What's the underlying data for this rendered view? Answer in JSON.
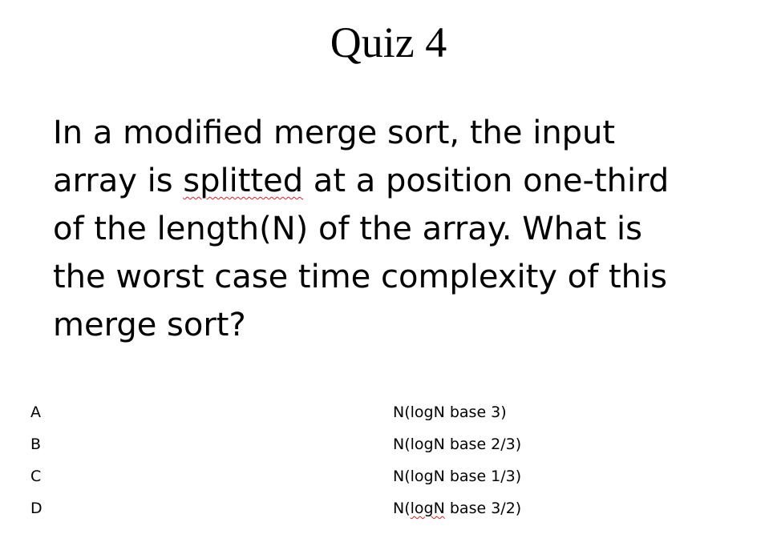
{
  "slide": {
    "title": "Quiz 4",
    "question_lines": [
      {
        "before": "In a modified merge sort, the input",
        "flagged": "",
        "after": ""
      },
      {
        "before": "array is ",
        "flagged": "splitted",
        "after": " at a position one-third"
      },
      {
        "before": "of the length(N) of the array. What is",
        "flagged": "",
        "after": ""
      },
      {
        "before": "the worst case time complexity of this",
        "flagged": "",
        "after": ""
      },
      {
        "before": "merge sort?",
        "flagged": "",
        "after": ""
      }
    ],
    "options": [
      {
        "letter": "A",
        "before": "N(logN base 3)",
        "flagged": "",
        "after": ""
      },
      {
        "letter": "B",
        "before": "N(logN base 2/3)",
        "flagged": "",
        "after": ""
      },
      {
        "letter": "C",
        "before": "N(logN base 1/3)",
        "flagged": "",
        "after": ""
      },
      {
        "letter": "D",
        "before": "N(",
        "flagged": "logN",
        "after": " base 3/2)"
      }
    ]
  }
}
